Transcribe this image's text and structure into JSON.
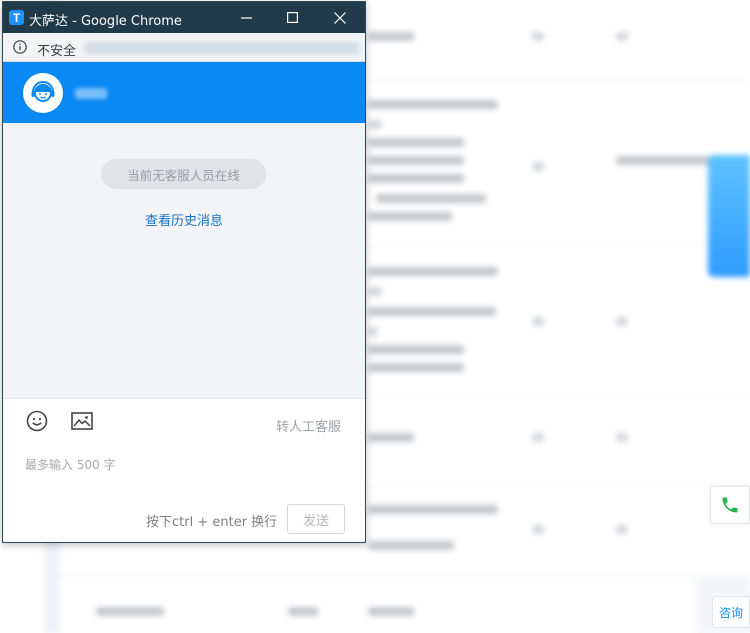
{
  "window": {
    "title": "大萨达 - Google Chrome",
    "app_icon_letter": "T"
  },
  "address_bar": {
    "security_label": "不安全"
  },
  "chat": {
    "status_text": "当前无客服人员在线",
    "history_link": "查看历史消息",
    "transfer_label": "转人工客服",
    "input_placeholder": "最多输入 500 字",
    "hint": "按下ctrl + enter 换行",
    "send_label": "发送"
  },
  "side_widgets": {
    "consult_label": "咨询",
    "phone_icon": "phone-icon"
  },
  "colors": {
    "header_blue": "#0a88f4",
    "titlebar": "#213a49",
    "link_blue": "#1572c6",
    "phone_green": "#2bb24c"
  }
}
